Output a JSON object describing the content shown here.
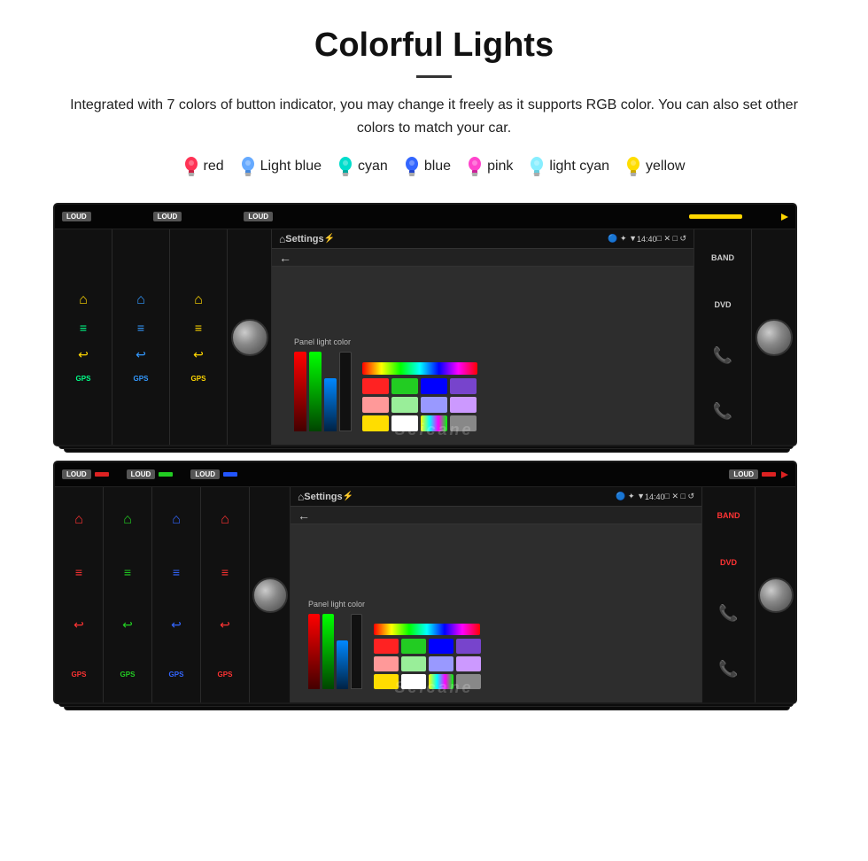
{
  "page": {
    "title": "Colorful Lights",
    "description": "Integrated with 7 colors of button indicator, you may change it freely as it supports RGB color. You can also set other colors to match your car.",
    "colors": [
      {
        "name": "red",
        "color": "#ff3355",
        "bulb_color": "#ff3355"
      },
      {
        "name": "Light blue",
        "color": "#66aaff",
        "bulb_color": "#66aaff"
      },
      {
        "name": "cyan",
        "color": "#00ddcc",
        "bulb_color": "#00ddcc"
      },
      {
        "name": "blue",
        "color": "#3366ff",
        "bulb_color": "#3366ff"
      },
      {
        "name": "pink",
        "color": "#ff44cc",
        "bulb_color": "#ff44cc"
      },
      {
        "name": "light cyan",
        "color": "#88eeff",
        "bulb_color": "#88eeff"
      },
      {
        "name": "yellow",
        "color": "#ffdd00",
        "bulb_color": "#ffdd00"
      }
    ],
    "top_unit": {
      "loud_label": "LOUD",
      "settings_label": "Settings",
      "time": "14:40",
      "panel_light_title": "Panel light color",
      "watermark": "Seicane",
      "top_bar_indicators": [
        {
          "color": "#ffd700"
        },
        {
          "color": "#00ff00"
        },
        {
          "color": "#0088ff"
        }
      ],
      "button_labels": {
        "band": "BAND",
        "dvd": "DVD"
      }
    },
    "bottom_unit": {
      "loud_label": "LOUD",
      "settings_label": "Settings",
      "time": "14:40",
      "panel_light_title": "Panel light color",
      "watermark": "Seicane",
      "button_labels": {
        "band": "BAND",
        "dvd": "DVD"
      }
    }
  }
}
